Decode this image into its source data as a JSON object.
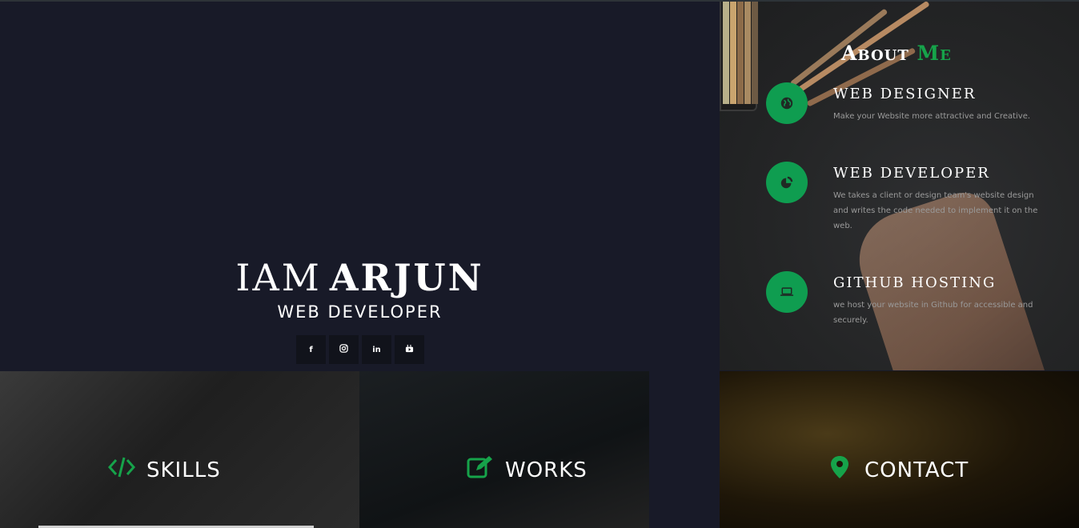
{
  "hero": {
    "title_prefix": "IAM",
    "title_name": "ARJUN",
    "subtitle": "WEB DEVELOPER",
    "socials": [
      {
        "icon": "facebook-icon",
        "label": "f"
      },
      {
        "icon": "instagram-icon",
        "label": ""
      },
      {
        "icon": "linkedin-icon",
        "label": "in"
      },
      {
        "icon": "youtube-icon",
        "label": ""
      }
    ]
  },
  "about": {
    "title_main": "About",
    "title_accent": "Me",
    "accent_color": "#16a34a",
    "services": [
      {
        "icon": "globe-icon",
        "title": "WEB DESIGNER",
        "desc": "Make your Website more attractive and Creative."
      },
      {
        "icon": "pie-chart-icon",
        "title": "WEB DEVELOPER",
        "desc": "We takes a client or design team's website design and writes the code needed to implement it on the web."
      },
      {
        "icon": "laptop-icon",
        "title": "GITHUB HOSTING",
        "desc": "we host your website in Github for accessible and securely."
      }
    ]
  },
  "tiles": {
    "skills": {
      "label": "SKILLS",
      "icon": "code-icon"
    },
    "works": {
      "label": "WORKS",
      "icon": "edit-icon"
    },
    "contact": {
      "label": "CONTACT",
      "icon": "map-marker-icon"
    }
  }
}
